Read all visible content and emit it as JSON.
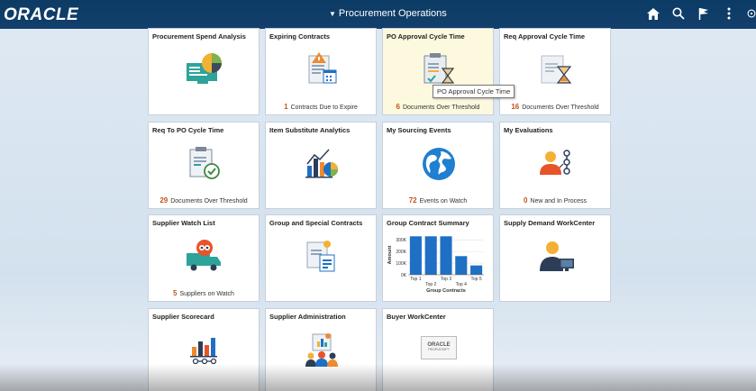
{
  "header": {
    "logo": "ORACLE",
    "title": "Procurement Operations",
    "icons": [
      "home-icon",
      "search-icon",
      "flag-icon",
      "more-icon",
      "circle-icon"
    ]
  },
  "tooltip": "PO Approval Cycle Time",
  "tiles": [
    {
      "title": "Procurement Spend Analysis",
      "count": "",
      "label": ""
    },
    {
      "title": "Expiring Contracts",
      "count": "1",
      "label": "Contracts Due to Expire"
    },
    {
      "title": "PO Approval Cycle Time",
      "count": "6",
      "label": "Documents Over Threshold"
    },
    {
      "title": "Req Approval Cycle Time",
      "count": "16",
      "label": "Documents Over Threshold"
    },
    {
      "title": "Req To PO Cycle Time",
      "count": "29",
      "label": "Documents Over Threshold"
    },
    {
      "title": "Item Substitute Analytics",
      "count": "",
      "label": ""
    },
    {
      "title": "My Sourcing Events",
      "count": "72",
      "label": "Events on Watch"
    },
    {
      "title": "My Evaluations",
      "count": "0",
      "label": "New and In Process"
    },
    {
      "title": "Supplier Watch List",
      "count": "5",
      "label": "Suppliers on Watch"
    },
    {
      "title": "Group and Special Contracts",
      "count": "",
      "label": ""
    },
    {
      "title": "Group Contract Summary",
      "count": "",
      "label": ""
    },
    {
      "title": "Supply Demand WorkCenter",
      "count": "",
      "label": ""
    },
    {
      "title": "Supplier Scorecard",
      "count": "",
      "label": ""
    },
    {
      "title": "Supplier Administration",
      "count": "",
      "label": ""
    },
    {
      "title": "Buyer WorkCenter",
      "count": "",
      "label": ""
    }
  ],
  "buyer_logo": {
    "line1": "ORACLE",
    "line2": "PEOPLESOFT"
  },
  "chart_data": {
    "type": "bar",
    "title": "",
    "xlabel": "Group Contracts",
    "ylabel": "Amount",
    "categories": [
      "Top 1",
      "Top 2",
      "Top 3",
      "Top 4",
      "Top 5"
    ],
    "values": [
      330000,
      330000,
      330000,
      160000,
      80000
    ],
    "yticks": [
      "0K",
      "100K",
      "200K",
      "300K"
    ],
    "ylim": [
      0,
      340000
    ],
    "color": "#1f6fc5"
  },
  "colors": {
    "header": "#0c3b66",
    "accent": "#c0541a",
    "highlight": "#fdf9df"
  }
}
